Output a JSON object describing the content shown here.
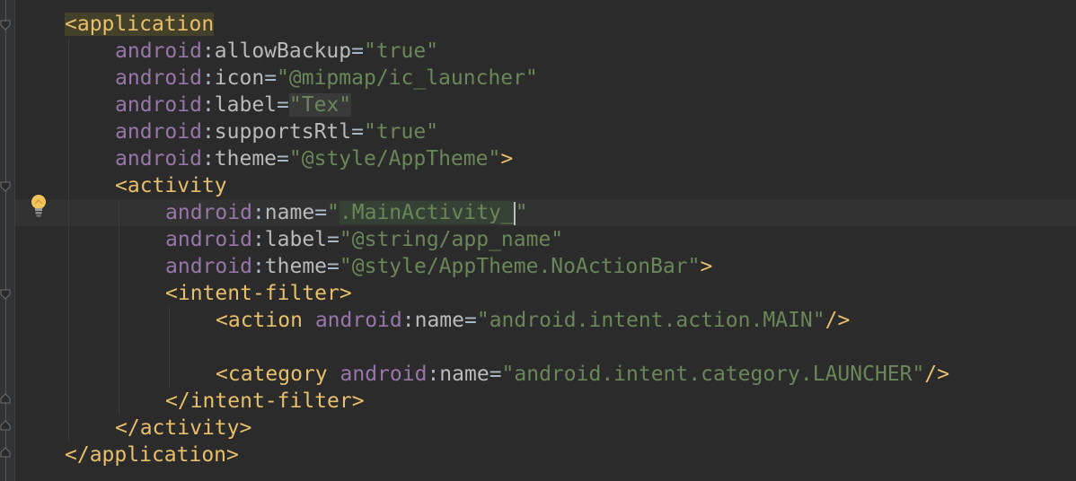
{
  "editor": {
    "lines": {
      "l1": {
        "open": "<",
        "tag": "application"
      },
      "l2": {
        "ns": "android",
        "colon": ":",
        "attr": "allowBackup",
        "eq": "=",
        "value": "\"true\""
      },
      "l3": {
        "ns": "android",
        "colon": ":",
        "attr": "icon",
        "eq": "=",
        "value": "\"@mipmap/ic_launcher\""
      },
      "l4": {
        "ns": "android",
        "colon": ":",
        "attr": "label",
        "eq": "=",
        "value": "\"Tex\""
      },
      "l5": {
        "ns": "android",
        "colon": ":",
        "attr": "supportsRtl",
        "eq": "=",
        "value": "\"true\""
      },
      "l6": {
        "ns": "android",
        "colon": ":",
        "attr": "theme",
        "eq": "=",
        "value": "\"@style/AppTheme\"",
        "close": ">"
      },
      "l7": {
        "open": "<",
        "tag": "activity"
      },
      "l8": {
        "ns": "android",
        "colon": ":",
        "attr": "name",
        "eq": "=",
        "q1": "\"",
        "value": ".MainActivity_",
        "q2": "\""
      },
      "l9": {
        "ns": "android",
        "colon": ":",
        "attr": "label",
        "eq": "=",
        "value": "\"@string/app_name\""
      },
      "l10": {
        "ns": "android",
        "colon": ":",
        "attr": "theme",
        "eq": "=",
        "value": "\"@style/AppTheme.NoActionBar\"",
        "close": ">"
      },
      "l11": {
        "open": "<",
        "tag": "intent-filter",
        "close": ">"
      },
      "l12": {
        "open": "<",
        "tag": "action",
        "sp": " ",
        "ns": "android",
        "colon": ":",
        "attr": "name",
        "eq": "=",
        "value": "\"android.intent.action.MAIN\"",
        "close": "/>"
      },
      "l14": {
        "open": "<",
        "tag": "category",
        "sp": " ",
        "ns": "android",
        "colon": ":",
        "attr": "name",
        "eq": "=",
        "value": "\"android.intent.category.LAUNCHER\"",
        "close": "/>"
      },
      "l15": {
        "open": "</",
        "tag": "intent-filter",
        "close": ">"
      },
      "l16": {
        "open": "</",
        "tag": "activity",
        "close": ">"
      },
      "l17": {
        "open": "</",
        "tag": "application",
        "close": ">"
      }
    },
    "intention_icon": "lightbulb-icon",
    "colors": {
      "background": "#2b2b2b",
      "tag": "#e8bf6a",
      "namespace": "#9876aa",
      "attribute": "#bababa",
      "string": "#6a8759"
    }
  }
}
